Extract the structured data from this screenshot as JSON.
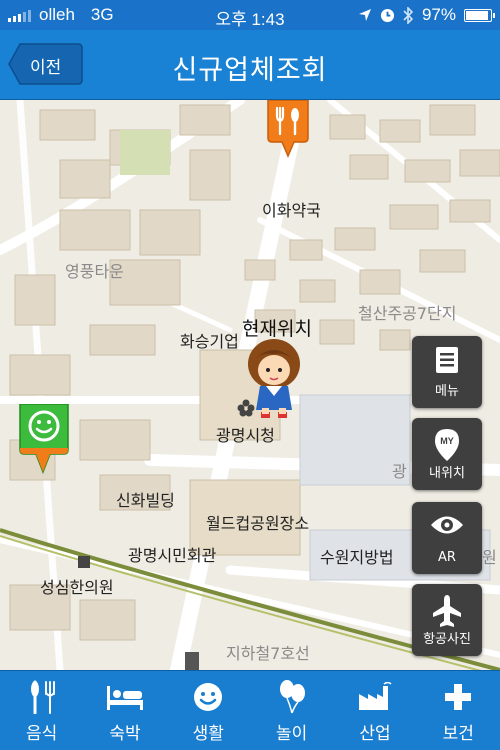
{
  "status_bar": {
    "carrier": "olleh",
    "network": "3G",
    "time": "오후 1:43",
    "battery": "97%",
    "battery_level": 0.97
  },
  "navbar": {
    "back_label": "이전",
    "title": "신규업체조회"
  },
  "map": {
    "labels": {
      "ihwa_pharmacy": "이화약국",
      "yeongpung_town": "영풍타운",
      "cheolsan": "철산주공7단지",
      "hwaseung": "화승기업",
      "city_hall": "광명시청",
      "sinhwa": "신화빌딩",
      "world_cup_park": "월드컵공원장소",
      "civic_hall": "광명시민회관",
      "suwon_court": "수원지방법",
      "seongsim": "성심한의원",
      "subway": "지하철7호선",
      "gwang_partial": "광",
      "edge_partial": "원"
    },
    "current_location_label": "현재위치"
  },
  "side_buttons": {
    "menu": "메뉴",
    "my_location": "내위치",
    "my_badge": "MY",
    "ar": "AR",
    "aerial": "항공사진"
  },
  "tabs": [
    {
      "label": "음식",
      "icon": "utensils-icon"
    },
    {
      "label": "숙박",
      "icon": "bed-icon"
    },
    {
      "label": "생활",
      "icon": "smiley-icon"
    },
    {
      "label": "놀이",
      "icon": "balloons-icon"
    },
    {
      "label": "산업",
      "icon": "factory-icon"
    },
    {
      "label": "보건",
      "icon": "plus-cross-icon"
    }
  ],
  "colors": {
    "bar_blue": "#1a82d4",
    "food_pin": "#f07d1a",
    "life_pin": "#3dbb3d"
  }
}
